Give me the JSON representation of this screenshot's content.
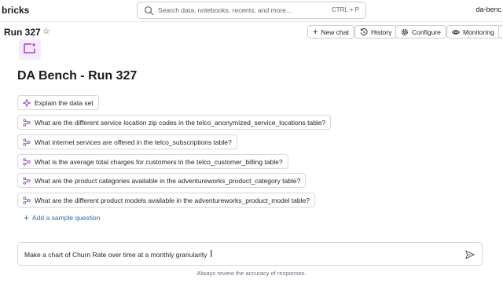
{
  "app": {
    "brand": "bricks",
    "user": "da-benc"
  },
  "search": {
    "placeholder": "Search data, notebooks, recents, and more...",
    "shortcut": "CTRL + P"
  },
  "header": {
    "title": "Run 327",
    "buttons": {
      "new_chat": "New chat",
      "history": "History",
      "configure": "Configure",
      "monitoring": "Monitoring"
    }
  },
  "space": {
    "title": "DA Bench - Run 327"
  },
  "samples": [
    "Explain the data set",
    "What are the different service location zip codes in the telco_anonymized_service_locations table?",
    "What internet services are offered in the telco_subscriptions table?",
    "What is the average total charges for customers in the telco_customer_billing table?",
    "What are the product categories available in the adventureworks_product_category table?",
    "What are the different product models available in the adventureworks_product_model table?"
  ],
  "add_question": "Add a sample question",
  "chat": {
    "value": "Make a chart of Churn Rate over time at a monthly granularity"
  },
  "footnote": "Always review the accuracy of responses.",
  "colors": {
    "accent": "#2272b4",
    "sparkle": "#9b3fd8",
    "tile_bg": "#f5ecfb",
    "border": "#d4d8dd"
  }
}
